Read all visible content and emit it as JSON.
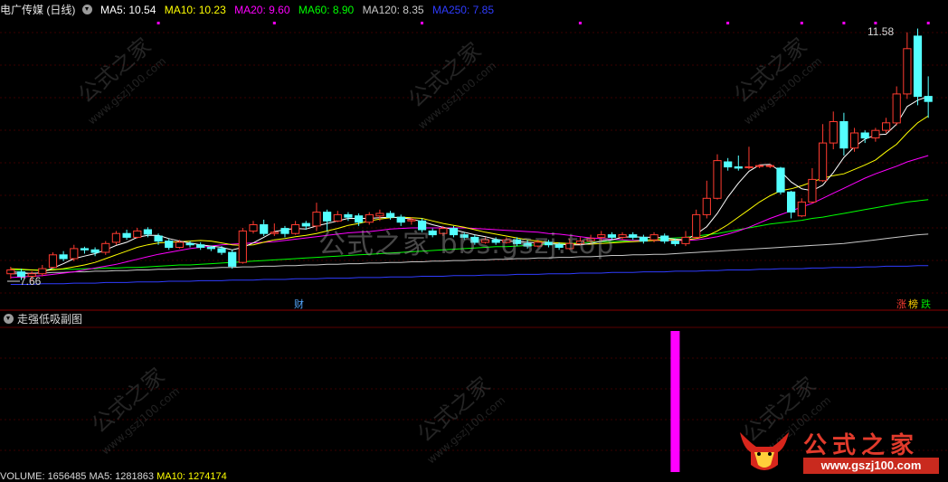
{
  "header": {
    "stock_name": "电广传媒 (日线)",
    "ma5": "MA5: 10.54",
    "ma10": "MA10: 10.23",
    "ma20": "MA20: 9.60",
    "ma60": "MA60: 8.90",
    "ma120": "MA120: 8.35",
    "ma250": "MA250: 7.85",
    "colors": {
      "ma5": "#ffffff",
      "ma10": "#ffff00",
      "ma20": "#ff00ff",
      "ma60": "#00ff00",
      "ma120": "#c8c8c8",
      "ma250": "#2f3cff"
    }
  },
  "price_labels": {
    "high": "11.58",
    "low": "7.66"
  },
  "badges": {
    "cai": "财",
    "zhang": "涨",
    "bang": "榜",
    "die": "跌"
  },
  "subchart": {
    "title": "走强低吸副图",
    "bar_color": "#ff00ff"
  },
  "volume_line": {
    "volume": "VOLUME: 1656485",
    "ma5": "MA5: 1281863",
    "ma10": "MA10: 1274174"
  },
  "watermark": {
    "text": "公式之家 bbs.gszj.top",
    "diag": "公式之家",
    "diag_url": "www.gszj100.com"
  },
  "logo": {
    "text": "公式之家",
    "url": "www.gszj100.com"
  },
  "chart_data": {
    "type": "candlestick",
    "y_range": [
      7.5,
      11.7
    ],
    "up_color": "#ff3b30",
    "down_color": "#54ffff",
    "candles": [
      [
        7.72,
        7.78,
        7.64,
        7.83
      ],
      [
        7.75,
        7.68,
        7.62,
        7.8
      ],
      [
        7.68,
        7.72,
        7.6,
        7.76
      ],
      [
        7.72,
        7.8,
        7.68,
        7.86
      ],
      [
        7.82,
        8.02,
        7.8,
        8.06
      ],
      [
        8.02,
        7.96,
        7.92,
        8.08
      ],
      [
        7.96,
        8.12,
        7.92,
        8.18
      ],
      [
        8.12,
        8.1,
        8.04,
        8.15
      ],
      [
        8.1,
        8.06,
        8.0,
        8.14
      ],
      [
        8.06,
        8.2,
        8.02,
        8.24
      ],
      [
        8.22,
        8.36,
        8.18,
        8.4
      ],
      [
        8.36,
        8.3,
        8.26,
        8.42
      ],
      [
        8.3,
        8.4,
        8.28,
        8.45
      ],
      [
        8.42,
        8.35,
        8.3,
        8.46
      ],
      [
        8.32,
        8.24,
        8.18,
        8.36
      ],
      [
        8.24,
        8.14,
        8.1,
        8.28
      ],
      [
        8.14,
        8.22,
        8.12,
        8.26
      ],
      [
        8.2,
        8.18,
        8.14,
        8.24
      ],
      [
        8.18,
        8.14,
        8.1,
        8.22
      ],
      [
        8.14,
        8.12,
        8.08,
        8.16
      ],
      [
        8.12,
        8.06,
        8.02,
        8.16
      ],
      [
        8.06,
        7.84,
        7.8,
        8.1
      ],
      [
        7.9,
        8.4,
        7.88,
        8.45
      ],
      [
        8.4,
        8.5,
        8.36,
        8.56
      ],
      [
        8.5,
        8.36,
        8.32,
        8.58
      ],
      [
        8.36,
        8.38,
        8.32,
        8.52
      ],
      [
        8.44,
        8.36,
        8.3,
        8.48
      ],
      [
        8.36,
        8.5,
        8.34,
        8.56
      ],
      [
        8.52,
        8.48,
        8.42,
        8.56
      ],
      [
        8.48,
        8.7,
        8.4,
        8.85
      ],
      [
        8.7,
        8.56,
        8.4,
        8.74
      ],
      [
        8.56,
        8.66,
        8.54,
        8.72
      ],
      [
        8.66,
        8.62,
        8.56,
        8.7
      ],
      [
        8.64,
        8.54,
        8.48,
        8.68
      ],
      [
        8.54,
        8.66,
        8.5,
        8.7
      ],
      [
        8.64,
        8.68,
        8.56,
        8.74
      ],
      [
        8.68,
        8.62,
        8.58,
        8.72
      ],
      [
        8.62,
        8.54,
        8.48,
        8.66
      ],
      [
        8.56,
        8.58,
        8.5,
        8.62
      ],
      [
        8.56,
        8.42,
        8.38,
        8.6
      ],
      [
        8.4,
        8.34,
        8.3,
        8.44
      ],
      [
        8.36,
        8.44,
        8.32,
        8.48
      ],
      [
        8.44,
        8.34,
        8.3,
        8.48
      ],
      [
        8.34,
        8.3,
        8.26,
        8.38
      ],
      [
        8.3,
        8.22,
        8.18,
        8.34
      ],
      [
        8.22,
        8.26,
        8.2,
        8.3
      ],
      [
        8.26,
        8.22,
        8.18,
        8.3
      ],
      [
        8.22,
        8.26,
        8.2,
        8.3
      ],
      [
        8.26,
        8.2,
        8.16,
        8.3
      ],
      [
        8.2,
        8.16,
        8.12,
        8.26
      ],
      [
        8.16,
        8.22,
        8.14,
        8.26
      ],
      [
        8.22,
        8.18,
        8.14,
        8.26
      ],
      [
        8.18,
        8.14,
        8.1,
        8.22
      ],
      [
        8.12,
        8.2,
        8.1,
        8.28
      ],
      [
        8.2,
        8.24,
        8.18,
        8.3
      ],
      [
        8.24,
        8.28,
        8.2,
        8.34
      ],
      [
        8.3,
        8.34,
        8.24,
        8.4
      ],
      [
        8.34,
        8.3,
        8.26,
        8.38
      ],
      [
        8.3,
        8.34,
        8.26,
        8.38
      ],
      [
        8.34,
        8.3,
        8.26,
        8.38
      ],
      [
        8.3,
        8.24,
        8.2,
        8.34
      ],
      [
        8.26,
        8.34,
        8.22,
        8.38
      ],
      [
        8.32,
        8.24,
        8.2,
        8.36
      ],
      [
        8.24,
        8.2,
        8.16,
        8.28
      ],
      [
        8.2,
        8.3,
        8.16,
        8.4
      ],
      [
        8.3,
        8.66,
        8.28,
        8.74
      ],
      [
        8.66,
        8.92,
        8.6,
        9.2
      ],
      [
        8.92,
        9.52,
        8.9,
        9.62
      ],
      [
        9.5,
        9.42,
        9.36,
        9.56
      ],
      [
        9.42,
        9.4,
        9.36,
        9.6
      ],
      [
        9.42,
        9.42,
        9.38,
        9.74
      ],
      [
        9.44,
        9.44,
        9.4,
        9.46
      ],
      [
        9.44,
        9.44,
        9.4,
        9.46
      ],
      [
        9.4,
        9.02,
        8.98,
        9.42
      ],
      [
        9.02,
        8.7,
        8.6,
        9.04
      ],
      [
        8.64,
        8.86,
        8.62,
        8.92
      ],
      [
        8.86,
        9.22,
        8.84,
        9.4
      ],
      [
        9.2,
        9.8,
        9.18,
        10.1
      ],
      [
        9.8,
        10.14,
        9.7,
        10.3
      ],
      [
        10.14,
        9.72,
        9.6,
        10.28
      ],
      [
        9.72,
        9.96,
        9.66,
        10.04
      ],
      [
        9.96,
        9.88,
        9.8,
        10.0
      ],
      [
        9.88,
        10.0,
        9.82,
        10.04
      ],
      [
        10.0,
        10.12,
        9.96,
        10.2
      ],
      [
        10.12,
        10.58,
        10.08,
        10.7
      ],
      [
        10.58,
        11.3,
        10.5,
        11.56
      ],
      [
        11.5,
        10.54,
        10.4,
        11.62
      ],
      [
        10.54,
        10.46,
        10.2,
        10.86
      ]
    ],
    "ma5": [
      7.75,
      7.74,
      7.72,
      7.74,
      7.81,
      7.88,
      7.96,
      8.0,
      8.04,
      8.1,
      8.17,
      8.22,
      8.3,
      8.33,
      8.33,
      8.28,
      8.24,
      8.21,
      8.18,
      8.16,
      8.14,
      8.1,
      8.14,
      8.21,
      8.3,
      8.39,
      8.42,
      8.44,
      8.43,
      8.48,
      8.52,
      8.56,
      8.6,
      8.6,
      8.6,
      8.61,
      8.62,
      8.61,
      8.59,
      8.55,
      8.5,
      8.46,
      8.42,
      8.38,
      8.34,
      8.31,
      8.27,
      8.24,
      8.23,
      8.22,
      8.21,
      8.2,
      8.19,
      8.18,
      8.18,
      8.2,
      8.24,
      8.26,
      8.3,
      8.31,
      8.3,
      8.3,
      8.29,
      8.27,
      8.26,
      8.35,
      8.47,
      8.68,
      8.94,
      9.16,
      9.35,
      9.45,
      9.46,
      9.35,
      9.18,
      9.07,
      9.04,
      9.13,
      9.33,
      9.57,
      9.74,
      9.86,
      9.93,
      9.94,
      10.1,
      10.38,
      10.48,
      10.54
    ],
    "ma10": [
      7.8,
      7.79,
      7.78,
      7.77,
      7.78,
      7.8,
      7.83,
      7.86,
      7.9,
      7.96,
      8.02,
      8.08,
      8.14,
      8.18,
      8.21,
      8.22,
      8.23,
      8.24,
      8.25,
      8.24,
      8.21,
      8.18,
      8.17,
      8.18,
      8.22,
      8.26,
      8.28,
      8.31,
      8.33,
      8.36,
      8.4,
      8.44,
      8.49,
      8.52,
      8.56,
      8.59,
      8.61,
      8.62,
      8.61,
      8.6,
      8.56,
      8.52,
      8.49,
      8.46,
      8.42,
      8.38,
      8.35,
      8.32,
      8.29,
      8.26,
      8.24,
      8.22,
      8.21,
      8.2,
      8.19,
      8.19,
      8.2,
      8.21,
      8.22,
      8.23,
      8.24,
      8.25,
      8.26,
      8.26,
      8.26,
      8.28,
      8.32,
      8.4,
      8.5,
      8.62,
      8.74,
      8.86,
      8.96,
      9.04,
      9.07,
      9.12,
      9.18,
      9.24,
      9.28,
      9.31,
      9.38,
      9.45,
      9.53,
      9.66,
      9.78,
      9.96,
      10.12,
      10.23
    ],
    "ma20": [
      7.66,
      7.67,
      7.68,
      7.69,
      7.71,
      7.73,
      7.75,
      7.78,
      7.81,
      7.84,
      7.87,
      7.91,
      7.95,
      7.99,
      8.03,
      8.06,
      8.09,
      8.12,
      8.14,
      8.16,
      8.18,
      8.19,
      8.2,
      8.21,
      8.22,
      8.23,
      8.25,
      8.27,
      8.29,
      8.31,
      8.33,
      8.35,
      8.37,
      8.38,
      8.39,
      8.41,
      8.43,
      8.44,
      8.45,
      8.45,
      8.45,
      8.45,
      8.45,
      8.45,
      8.44,
      8.43,
      8.42,
      8.41,
      8.4,
      8.39,
      8.38,
      8.36,
      8.35,
      8.33,
      8.31,
      8.29,
      8.28,
      8.27,
      8.26,
      8.25,
      8.25,
      8.25,
      8.25,
      8.25,
      8.25,
      8.26,
      8.28,
      8.31,
      8.35,
      8.4,
      8.46,
      8.53,
      8.6,
      8.66,
      8.72,
      8.78,
      8.84,
      8.92,
      9.0,
      9.08,
      9.16,
      9.24,
      9.31,
      9.37,
      9.43,
      9.5,
      9.55,
      9.6
    ],
    "ma60": [
      7.78,
      7.78,
      7.78,
      7.78,
      7.79,
      7.79,
      7.79,
      7.8,
      7.8,
      7.81,
      7.81,
      7.82,
      7.82,
      7.83,
      7.84,
      7.85,
      7.86,
      7.86,
      7.87,
      7.88,
      7.89,
      7.9,
      7.91,
      7.92,
      7.93,
      7.94,
      7.95,
      7.96,
      7.97,
      7.98,
      7.99,
      8.0,
      8.01,
      8.02,
      8.03,
      8.04,
      8.05,
      8.06,
      8.07,
      8.08,
      8.09,
      8.1,
      8.11,
      8.12,
      8.13,
      8.14,
      8.15,
      8.15,
      8.16,
      8.17,
      8.18,
      8.19,
      8.19,
      8.2,
      8.21,
      8.22,
      8.23,
      8.23,
      8.24,
      8.25,
      8.26,
      8.27,
      8.28,
      8.29,
      8.3,
      8.32,
      8.34,
      8.36,
      8.39,
      8.42,
      8.45,
      8.48,
      8.51,
      8.53,
      8.55,
      8.57,
      8.6,
      8.62,
      8.65,
      8.68,
      8.71,
      8.74,
      8.77,
      8.8,
      8.83,
      8.86,
      8.88,
      8.9
    ],
    "ma120": [
      7.72,
      7.72,
      7.73,
      7.73,
      7.74,
      7.74,
      7.75,
      7.75,
      7.76,
      7.76,
      7.77,
      7.77,
      7.78,
      7.78,
      7.79,
      7.79,
      7.8,
      7.8,
      7.81,
      7.81,
      7.82,
      7.82,
      7.83,
      7.83,
      7.84,
      7.84,
      7.85,
      7.85,
      7.86,
      7.86,
      7.87,
      7.87,
      7.88,
      7.88,
      7.89,
      7.89,
      7.9,
      7.9,
      7.91,
      7.91,
      7.92,
      7.92,
      7.93,
      7.93,
      7.94,
      7.94,
      7.95,
      7.95,
      7.96,
      7.96,
      7.97,
      7.97,
      7.98,
      7.98,
      7.99,
      7.99,
      8.0,
      8.01,
      8.01,
      8.02,
      8.02,
      8.03,
      8.03,
      8.04,
      8.05,
      8.06,
      8.07,
      8.08,
      8.09,
      8.1,
      8.11,
      8.12,
      8.13,
      8.14,
      8.15,
      8.16,
      8.17,
      8.18,
      8.19,
      8.2,
      8.22,
      8.24,
      8.26,
      8.28,
      8.3,
      8.32,
      8.34,
      8.35
    ],
    "ma250": [
      7.55,
      7.55,
      7.55,
      7.56,
      7.56,
      7.56,
      7.57,
      7.57,
      7.57,
      7.58,
      7.58,
      7.58,
      7.59,
      7.59,
      7.59,
      7.6,
      7.6,
      7.6,
      7.61,
      7.61,
      7.61,
      7.62,
      7.62,
      7.62,
      7.63,
      7.63,
      7.63,
      7.64,
      7.64,
      7.64,
      7.65,
      7.65,
      7.65,
      7.66,
      7.66,
      7.66,
      7.67,
      7.67,
      7.67,
      7.68,
      7.68,
      7.68,
      7.69,
      7.69,
      7.69,
      7.7,
      7.7,
      7.7,
      7.71,
      7.71,
      7.71,
      7.72,
      7.72,
      7.72,
      7.73,
      7.73,
      7.73,
      7.74,
      7.74,
      7.74,
      7.75,
      7.75,
      7.75,
      7.76,
      7.76,
      7.76,
      7.77,
      7.77,
      7.78,
      7.78,
      7.78,
      7.79,
      7.79,
      7.8,
      7.8,
      7.8,
      7.81,
      7.81,
      7.82,
      7.82,
      7.82,
      7.83,
      7.83,
      7.84,
      7.84,
      7.84,
      7.85,
      7.85
    ],
    "signal_bar_index": 63,
    "top_marker_indices": [
      14,
      25,
      39,
      54,
      68,
      75,
      79,
      82,
      87
    ]
  }
}
